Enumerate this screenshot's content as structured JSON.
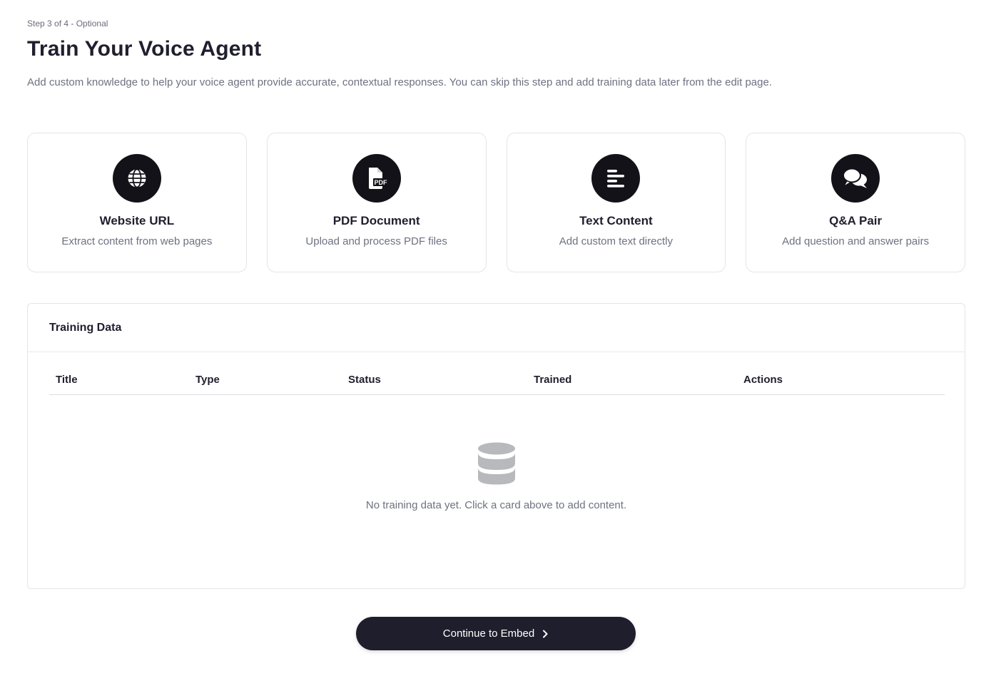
{
  "header": {
    "step": "Step 3 of 4 - Optional",
    "title": "Train Your Voice Agent",
    "subtitle": "Add custom knowledge to help your voice agent provide accurate, contextual responses. You can skip this step and add training data later from the edit page."
  },
  "cards": [
    {
      "icon": "globe-icon",
      "title": "Website URL",
      "description": "Extract content from web pages"
    },
    {
      "icon": "pdf-file-icon",
      "title": "PDF Document",
      "description": "Upload and process PDF files"
    },
    {
      "icon": "text-lines-icon",
      "title": "Text Content",
      "description": "Add custom text directly"
    },
    {
      "icon": "chat-bubbles-icon",
      "title": "Q&A Pair",
      "description": "Add question and answer pairs"
    }
  ],
  "training_data": {
    "title": "Training Data",
    "columns": [
      "Title",
      "Type",
      "Status",
      "Trained",
      "Actions"
    ],
    "rows": [],
    "empty_icon": "database-icon",
    "empty_message": "No training data yet. Click a card above to add content."
  },
  "footer": {
    "continue_label": "Continue to Embed",
    "continue_icon": "chevron-right-icon"
  },
  "colors": {
    "primary": "#1e1e2c",
    "icon_bg": "#121218",
    "muted_text": "#6e7280",
    "border": "#e3e5ea",
    "empty_icon": "#b7b9bd"
  }
}
